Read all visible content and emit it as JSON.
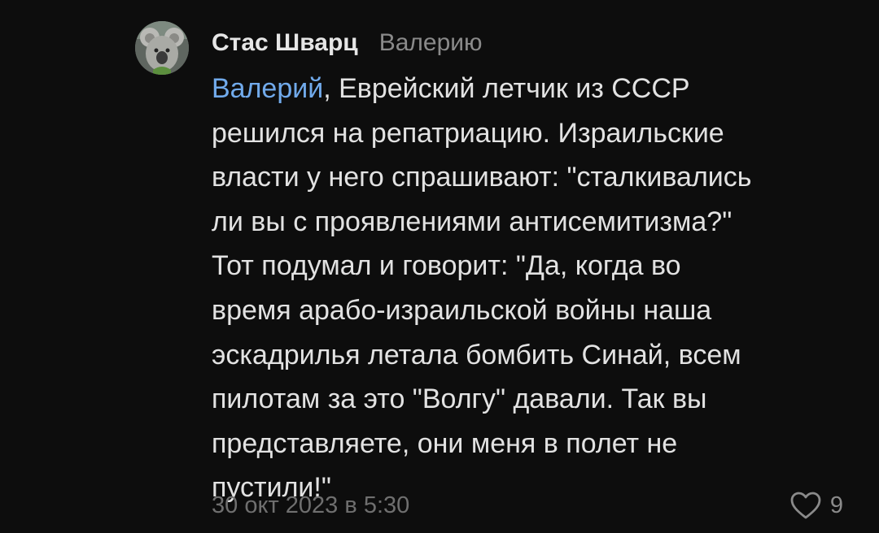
{
  "comment": {
    "author": "Стас Шварц",
    "reply_to": "Валерию",
    "mention": "Валерий",
    "lines": [
      ", Еврейский летчик из СССР",
      "решился на репатриацию. Израильские",
      "власти у него спрашивают: \"сталкивались",
      "ли вы с проявлениями антисемитизма?\"",
      "Тот подумал и говорит: \"Да, когда во",
      "время арабо-израильской войны наша",
      "эскадрилья летала бомбить Синай, всем",
      "пилотам за это \"Волгу\" давали. Так вы",
      "представляете, они меня в полет не",
      "пустили!\""
    ],
    "date": "30 окт 2023 в 5:30",
    "likes": "9",
    "avatar_icon": "koala-avatar",
    "like_icon": "heart-outline-icon"
  },
  "colors": {
    "background": "#0d0d0d",
    "text": "#e2e2e2",
    "mention": "#71aaeb",
    "secondary": "#8a8a8a",
    "date": "#6f6f6f"
  }
}
